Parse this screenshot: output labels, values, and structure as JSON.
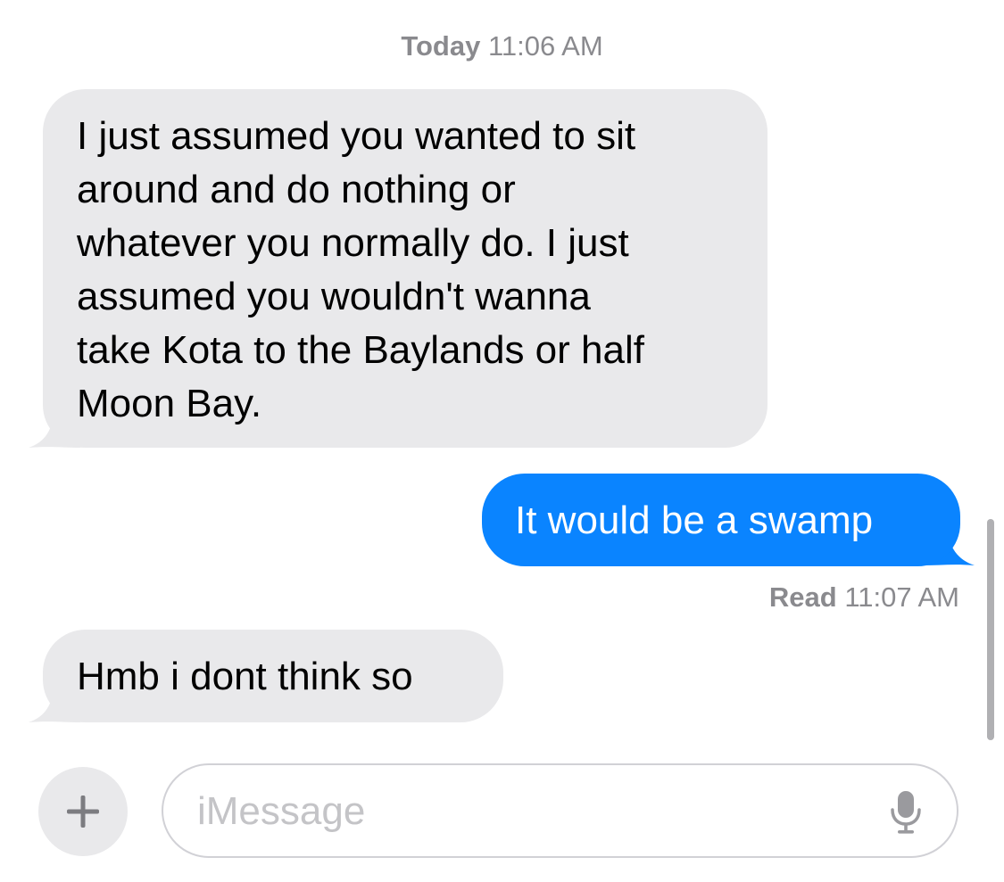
{
  "header": {
    "timestamp_day": "Today",
    "timestamp_time": "11:06 AM"
  },
  "messages": [
    {
      "direction": "received",
      "lines": [
        "I just assumed you wanted to sit",
        "around and do nothing or",
        "whatever you normally do. I just",
        "assumed you wouldn't wanna",
        "take Kota to the Baylands or half",
        "Moon Bay."
      ]
    },
    {
      "direction": "sent",
      "text": "It would be a swamp"
    },
    {
      "direction": "received",
      "text": "Hmb i dont think so"
    }
  ],
  "read_receipt": {
    "label": "Read",
    "time": "11:07 AM"
  },
  "composer": {
    "placeholder": "iMessage",
    "plus_icon": "plus-icon",
    "mic_icon": "microphone-icon"
  },
  "colors": {
    "sent_bubble": "#0a84ff",
    "received_bubble": "#e9e9eb",
    "meta_text": "#8a8a8e"
  }
}
